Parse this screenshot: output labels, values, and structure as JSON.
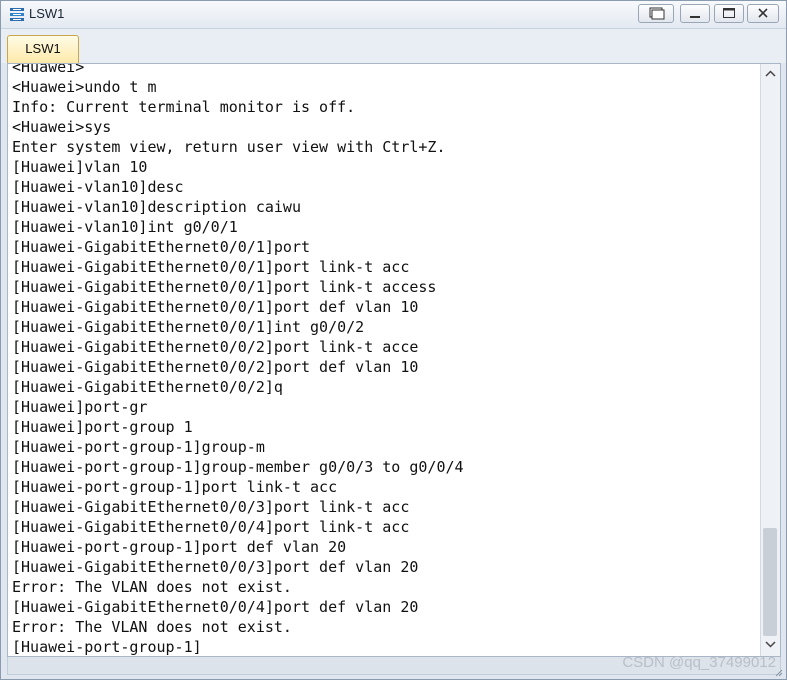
{
  "window": {
    "title": "LSW1"
  },
  "tabs": [
    {
      "label": "LSW1",
      "active": true
    }
  ],
  "terminal": {
    "lines": [
      "<Huawei>",
      "<Huawei>undo t m",
      "Info: Current terminal monitor is off.",
      "<Huawei>sys",
      "Enter system view, return user view with Ctrl+Z.",
      "[Huawei]vlan 10",
      "[Huawei-vlan10]desc",
      "[Huawei-vlan10]description caiwu",
      "[Huawei-vlan10]int g0/0/1",
      "[Huawei-GigabitEthernet0/0/1]port",
      "[Huawei-GigabitEthernet0/0/1]port link-t acc",
      "[Huawei-GigabitEthernet0/0/1]port link-t access",
      "[Huawei-GigabitEthernet0/0/1]port def vlan 10",
      "[Huawei-GigabitEthernet0/0/1]int g0/0/2",
      "[Huawei-GigabitEthernet0/0/2]port link-t acce",
      "[Huawei-GigabitEthernet0/0/2]port def vlan 10",
      "[Huawei-GigabitEthernet0/0/2]q",
      "[Huawei]port-gr",
      "[Huawei]port-group 1",
      "[Huawei-port-group-1]group-m",
      "[Huawei-port-group-1]group-member g0/0/3 to g0/0/4",
      "[Huawei-port-group-1]port link-t acc",
      "[Huawei-GigabitEthernet0/0/3]port link-t acc",
      "[Huawei-GigabitEthernet0/0/4]port link-t acc",
      "[Huawei-port-group-1]port def vlan 20",
      "[Huawei-GigabitEthernet0/0/3]port def vlan 20",
      "Error: The VLAN does not exist.",
      "[Huawei-GigabitEthernet0/0/4]port def vlan 20",
      "Error: The VLAN does not exist.",
      "[Huawei-port-group-1]"
    ]
  },
  "icons": {
    "app": "switch-icon",
    "restore": "restore-window-icon",
    "minimize": "minimize-icon",
    "maximize": "maximize-icon",
    "close": "close-icon",
    "scroll_up": "chevron-up-icon",
    "scroll_down": "chevron-down-icon"
  },
  "watermark": "CSDN @qq_37499012",
  "colors": {
    "terminal_text": "#111111",
    "tab_active": "#fdeaa9",
    "frame": "#dfe6ef"
  }
}
